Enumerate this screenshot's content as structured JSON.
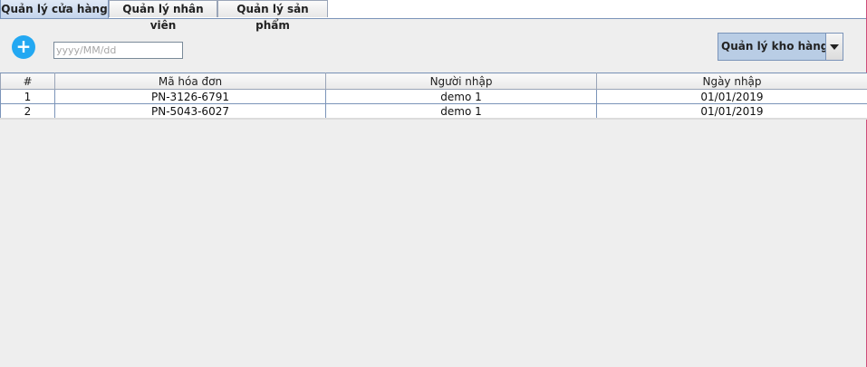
{
  "tabs": [
    {
      "label": "Quản lý cửa hàng",
      "active": true
    },
    {
      "label": "Quản lý nhân viên",
      "active": false
    },
    {
      "label": "Quản lý sản phẩm",
      "active": false
    }
  ],
  "toolbar": {
    "add_icon": "plus-icon",
    "add_glyph": "+",
    "date_placeholder": "yyyy/MM/dd",
    "date_value": "",
    "combo_selected": "Quản lý kho hàng"
  },
  "table": {
    "columns": [
      "#",
      "Mã hóa đơn",
      "Người nhập",
      "Ngày nhập"
    ],
    "rows": [
      [
        "1",
        "PN-3126-6791",
        "demo 1",
        "01/01/2019"
      ],
      [
        "2",
        "PN-5043-6027",
        "demo 1",
        "01/01/2019"
      ]
    ]
  },
  "colors": {
    "active_tab": "#c4d5ec",
    "add_button": "#23a8f2",
    "combo_background": "#b9cde5"
  }
}
